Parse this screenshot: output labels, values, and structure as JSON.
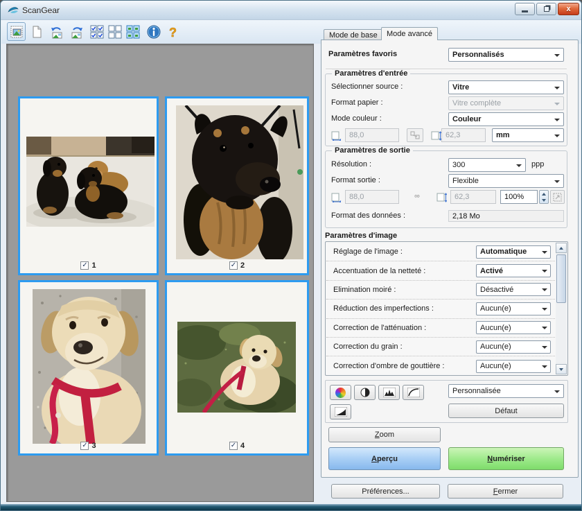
{
  "window": {
    "title": "ScanGear"
  },
  "window_controls": {
    "minimize": "minimize",
    "restore": "restore",
    "close": "close"
  },
  "toolbar": {
    "buttons": [
      "thumbnail-view",
      "clear-crop",
      "rotate-left",
      "rotate-right",
      "check-all-frames",
      "uncheck-all-frames",
      "select-all-frames",
      "information",
      "help"
    ]
  },
  "thumbnails": [
    {
      "label": "1"
    },
    {
      "label": "2"
    },
    {
      "label": "3"
    },
    {
      "label": "4"
    }
  ],
  "tabs": {
    "basic": "Mode de base",
    "advanced": "Mode avancé"
  },
  "favorites": {
    "label": "Paramètres favoris",
    "value": "Personnalisés"
  },
  "input": {
    "title": "Paramètres d'entrée",
    "source_label": "Sélectionner source :",
    "source_value": "Vitre",
    "paper_label": "Format papier :",
    "paper_value": "Vitre complète",
    "colormode_label": "Mode couleur :",
    "colormode_value": "Couleur",
    "width": "88,0",
    "height": "62,3",
    "unit": "mm"
  },
  "output": {
    "title": "Paramètres de sortie",
    "resolution_label": "Résolution :",
    "resolution_value": "300",
    "resolution_unit": "ppp",
    "format_label": "Format sortie :",
    "format_value": "Flexible",
    "width": "88,0",
    "height": "62,3",
    "scale": "100%",
    "datasize_label": "Format des données :",
    "datasize_value": "2,18 Mo"
  },
  "image_settings": {
    "title": "Paramètres d'image",
    "rows": [
      {
        "label": "Réglage de l'image :",
        "value": "Automatique"
      },
      {
        "label": "Accentuation de la netteté :",
        "value": "Activé"
      },
      {
        "label": "Elimination moiré :",
        "value": "Désactivé"
      },
      {
        "label": "Réduction des imperfections :",
        "value": "Aucun(e)"
      },
      {
        "label": "Correction de l'atténuation :",
        "value": "Aucun(e)"
      },
      {
        "label": "Correction du grain :",
        "value": "Aucun(e)"
      },
      {
        "label": "Correction d'ombre de gouttière :",
        "value": "Aucun(e)"
      }
    ]
  },
  "color_adjust": {
    "preset": "Personnalisée",
    "default_label": "Défaut",
    "buttons": [
      "saturation-color-balance",
      "brightness-contrast",
      "histogram",
      "tone-curve",
      "final-review"
    ]
  },
  "buttons": {
    "zoom": "Zoom",
    "preview": "Aperçu",
    "scan": "Numériser",
    "preferences": "Préférences...",
    "close": "Fermer"
  },
  "colors": {
    "selection_blue": "#2d9bf0",
    "preview_button_blue": "#a9cff5",
    "scan_button_green": "#9fea8c"
  }
}
